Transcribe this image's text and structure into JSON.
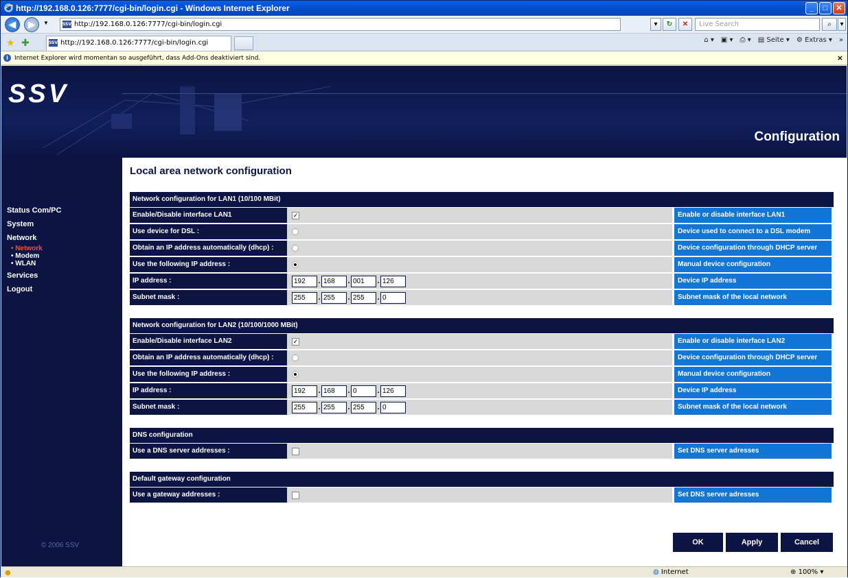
{
  "browser": {
    "title": "http://192.168.0.126:7777/cgi-bin/login.cgi - Windows Internet Explorer",
    "url": "http://192.168.0.126:7777/cgi-bin/login.cgi",
    "tab_title": "http://192.168.0.126:7777/cgi-bin/login.cgi",
    "search_placeholder": "Live Search",
    "toolbar": {
      "page": "Seite",
      "extras": "Extras"
    },
    "infobar": "Internet Explorer wird momentan so ausgeführt, dass Add-Ons deaktiviert sind.",
    "status_zone": "Internet",
    "zoom": "100%"
  },
  "site": {
    "logo": "SSV",
    "header_title": "Configuration",
    "copyright": "© 2006 SSV"
  },
  "nav": {
    "status": "Status Com/PC",
    "system": "System",
    "network": "Network",
    "sub_network": "• Network",
    "sub_modem": "• Modem",
    "sub_wlan": "• WLAN",
    "services": "Services",
    "logout": "Logout"
  },
  "page_title": "Local area network configuration",
  "lan1": {
    "header": "Network configuration for LAN1 (10/100 MBit)",
    "enable_label": "Enable/Disable interface LAN1",
    "enable_desc": "Enable or disable interface LAN1",
    "dsl_label": "Use device for DSL :",
    "dsl_desc": "Device used to connect to a DSL modem",
    "dhcp_label": "Obtain an IP address automatically (dhcp) :",
    "dhcp_desc": "Device configuration through DHCP server",
    "static_label": "Use the following IP address :",
    "static_desc": "Manual device configuration",
    "ip_label": "IP address :",
    "ip_desc": "Device IP address",
    "ip": [
      "192",
      "168",
      "001",
      "126"
    ],
    "mask_label": "Subnet mask :",
    "mask_desc": "Subnet mask of the local network",
    "mask": [
      "255",
      "255",
      "255",
      "0"
    ]
  },
  "lan2": {
    "header": "Network configuration for LAN2 (10/100/1000 MBit)",
    "enable_label": "Enable/Disable interface LAN2",
    "enable_desc": "Enable or disable interface LAN2",
    "dhcp_label": "Obtain an IP address automatically (dhcp) :",
    "dhcp_desc": "Device configuration through DHCP server",
    "static_label": "Use the following IP address :",
    "static_desc": "Manual device configuration",
    "ip_label": "IP address :",
    "ip_desc": "Device IP address",
    "ip": [
      "192",
      "168",
      "0",
      "126"
    ],
    "mask_label": "Subnet mask :",
    "mask_desc": "Subnet mask of the local network",
    "mask": [
      "255",
      "255",
      "255",
      "0"
    ]
  },
  "dns": {
    "header": "DNS configuration",
    "label": "Use a DNS server addresses :",
    "desc": "Set DNS server adresses"
  },
  "gateway": {
    "header": "Default gateway configuration",
    "label": "Use a gateway addresses :",
    "desc": "Set DNS server adresses"
  },
  "buttons": {
    "ok": "OK",
    "apply": "Apply",
    "cancel": "Cancel"
  },
  "colors": {
    "navy": "#0b1443",
    "blue": "#1276d6",
    "active": "#ff4a2a"
  }
}
